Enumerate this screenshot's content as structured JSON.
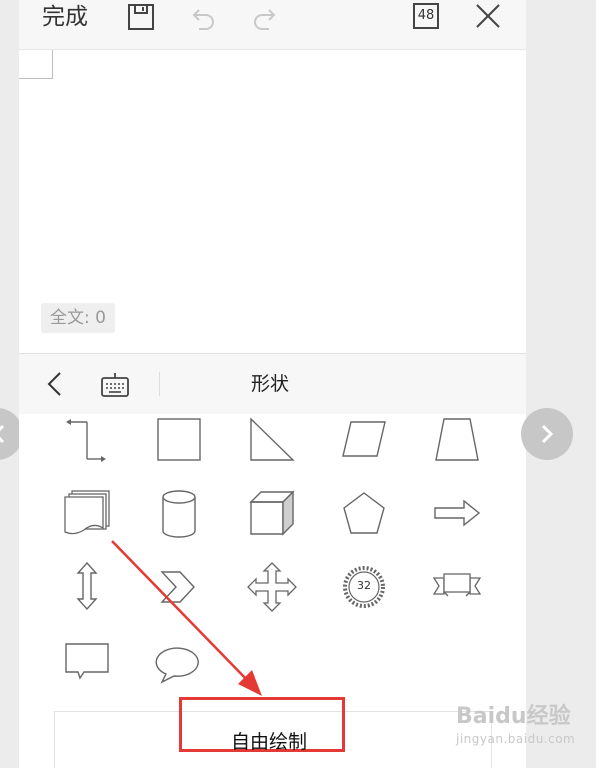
{
  "toolbar": {
    "done_label": "完成",
    "page_count": "48"
  },
  "editor": {
    "word_count": "全文: 0"
  },
  "panel": {
    "title": "形状"
  },
  "shapes": {
    "seal_number": "32"
  },
  "bottom": {
    "free_draw_label": "自由绘制"
  },
  "watermark": {
    "brand": "Baidu经验",
    "url": "jingyan.baidu.com"
  },
  "colors": {
    "annotation_red": "#e53935",
    "shape_stroke": "#666666"
  }
}
